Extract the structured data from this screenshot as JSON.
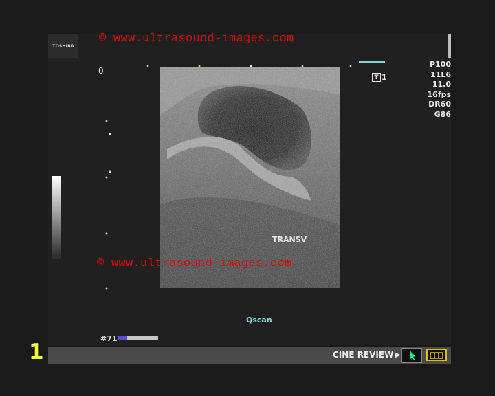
{
  "device": {
    "logo": "TOSHIBA"
  },
  "watermark": {
    "top": "© www.ultrasound-images.com",
    "bottom": "© www.ultrasound-images.com"
  },
  "depth_scale": {
    "zero_label": "0"
  },
  "parameters": [
    "P100",
    "11L6",
    "11.0",
    "16fps",
    "DR60",
    "G86"
  ],
  "probe": {
    "icon": "transducer-icon",
    "label": "1",
    "icon_letter": "T"
  },
  "annotation": {
    "view": "TRANSV"
  },
  "mode": {
    "label": "Qscan"
  },
  "cine": {
    "frame_label": "#71",
    "slider_level": 0.22,
    "review_label": "CINE REVIEW"
  },
  "frame_index": "1",
  "colors": {
    "watermark": "#e60000",
    "frame_index": "#ffff3a",
    "qscan": "#7fd4d4",
    "slider_fill": "#5a4fd0",
    "battery_border": "#e0c000"
  }
}
